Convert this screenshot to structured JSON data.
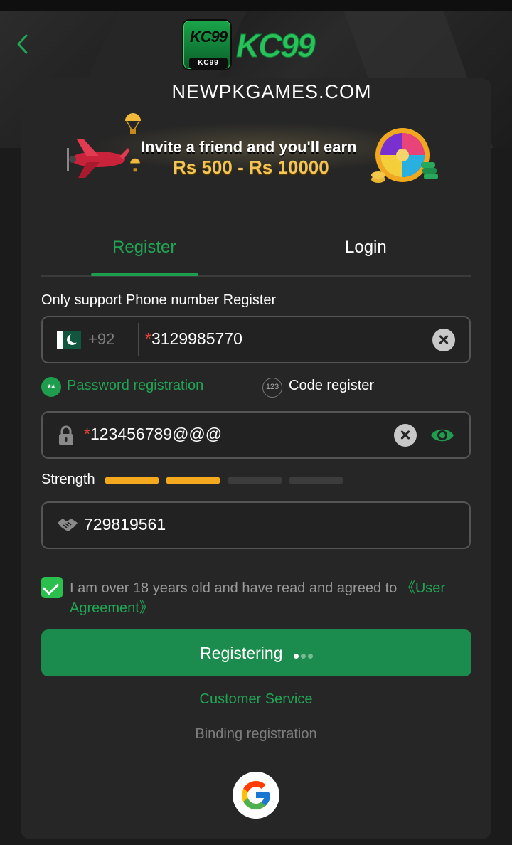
{
  "header": {
    "back_icon": "chevron-left-icon",
    "logo_badge_text": "KC99",
    "logo_badge_sub": "KC99",
    "logo_word": "KC99"
  },
  "site_title": "NEWPKGAMES.COM",
  "banner": {
    "line1": "Invite a friend and you'll earn",
    "line2": "Rs 500 - Rs 10000"
  },
  "tabs": [
    {
      "label": "Register",
      "active": true
    },
    {
      "label": "Login",
      "active": false
    }
  ],
  "hint": "Only support Phone number Register",
  "phone": {
    "country_code": "+92",
    "required_mark": "*",
    "value": "3129985770"
  },
  "modes": {
    "password_label": "Password registration",
    "password_icon_text": "**",
    "code_label": "Code register",
    "code_icon_text": "123"
  },
  "password": {
    "required_mark": "*",
    "value": "123456789@@@"
  },
  "strength": {
    "label": "Strength",
    "level": 2,
    "max": 4
  },
  "invite": {
    "value": "729819561"
  },
  "agreement": {
    "checked": true,
    "text": "I am over 18 years old and have read and agreed to ",
    "link": "《User Agreement》"
  },
  "submit_label": "Registering",
  "customer_service": "Customer Service",
  "binding_label": "Binding registration",
  "colors": {
    "accent": "#1f9d4f",
    "strength_on": "#f3a81d"
  }
}
